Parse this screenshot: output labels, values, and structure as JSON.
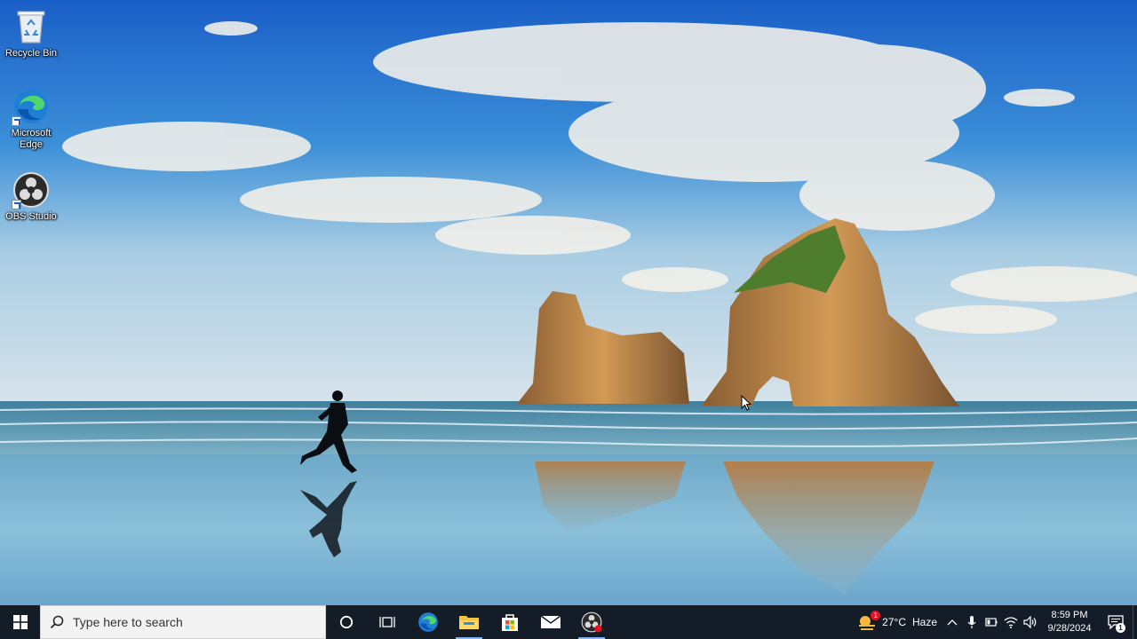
{
  "desktop": {
    "icons": [
      {
        "label": "Recycle Bin",
        "icon": "recycle-bin-icon"
      },
      {
        "label": "Microsoft Edge",
        "icon": "edge-icon"
      },
      {
        "label": "OBS Studio",
        "icon": "obs-icon"
      }
    ]
  },
  "taskbar": {
    "search_placeholder": "Type here to search",
    "pinned": [
      {
        "icon": "cortana-icon"
      },
      {
        "icon": "task-view-icon"
      },
      {
        "icon": "edge-icon"
      },
      {
        "icon": "file-explorer-icon"
      },
      {
        "icon": "microsoft-store-icon"
      },
      {
        "icon": "mail-icon"
      },
      {
        "icon": "obs-icon"
      }
    ],
    "weather": {
      "temperature": "27°C",
      "condition": "Haze",
      "badge": "1"
    },
    "clock": {
      "time": "8:59 PM",
      "date": "9/28/2024"
    },
    "notifications_count": "1"
  },
  "colors": {
    "taskbar_bg": "#141c27",
    "sky_top": "#1a63c8",
    "sky_bottom": "#cfe1ee",
    "accent": "#0078d4"
  }
}
